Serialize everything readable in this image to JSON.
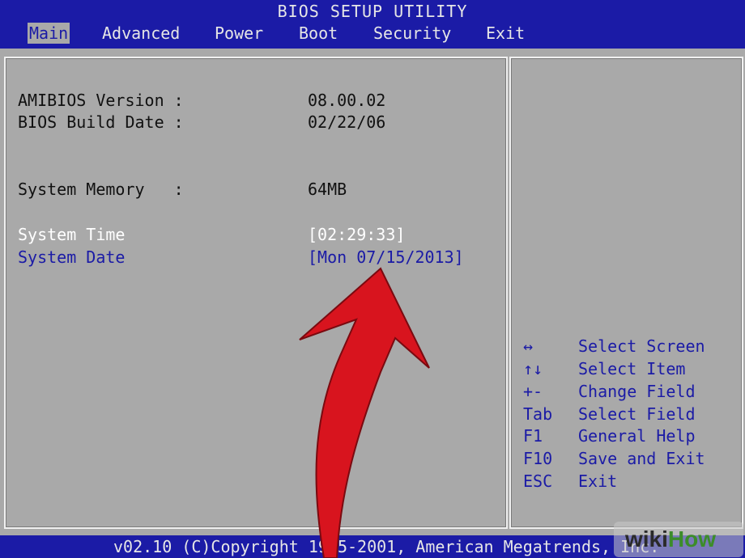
{
  "title": "BIOS SETUP UTILITY",
  "menu": [
    {
      "label": "Main",
      "active": true
    },
    {
      "label": "Advanced",
      "active": false
    },
    {
      "label": "Power",
      "active": false
    },
    {
      "label": "Boot",
      "active": false
    },
    {
      "label": "Security",
      "active": false
    },
    {
      "label": "Exit",
      "active": false
    }
  ],
  "info": {
    "amibios_label": "AMIBIOS Version :",
    "amibios_value": "08.00.02",
    "build_label": "BIOS Build Date :",
    "build_value": "02/22/06",
    "memory_label": "System Memory   :",
    "memory_value": "64MB",
    "time_label": "System Time",
    "time_value": "[02:29:33]",
    "date_label": "System Date",
    "date_value": "[Mon 07/15/2013]"
  },
  "help": [
    {
      "key": "↔",
      "desc": "Select Screen"
    },
    {
      "key": "↑↓",
      "desc": "Select Item"
    },
    {
      "key": "+-",
      "desc": "Change Field"
    },
    {
      "key": "Tab",
      "desc": "Select Field"
    },
    {
      "key": "F1",
      "desc": "General Help"
    },
    {
      "key": "F10",
      "desc": "Save and Exit"
    },
    {
      "key": "ESC",
      "desc": "Exit"
    }
  ],
  "footer": "v02.10 (C)Copyright 1985-2001, American Megatrends, Inc.",
  "watermark": {
    "part1": "wiki",
    "part2": "How"
  },
  "colors": {
    "bios_blue": "#1b1ba6",
    "panel_gray": "#a9a9a9",
    "arrow_red": "#d8141e"
  }
}
